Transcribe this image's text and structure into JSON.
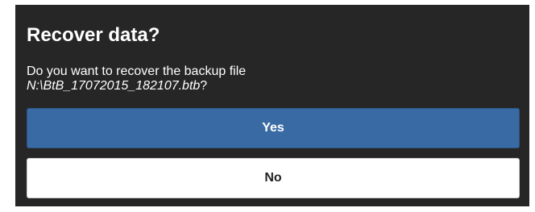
{
  "dialog": {
    "title": "Recover data?",
    "message_line1": "Do you want to recover the backup file",
    "message_path": "N:\\BtB_17072015_182107.btb",
    "message_suffix": "?",
    "yes_label": "Yes",
    "no_label": "No"
  },
  "colors": {
    "dialog_background": "#262626",
    "primary_button": "#3a6aa3",
    "secondary_button": "#ffffff"
  }
}
